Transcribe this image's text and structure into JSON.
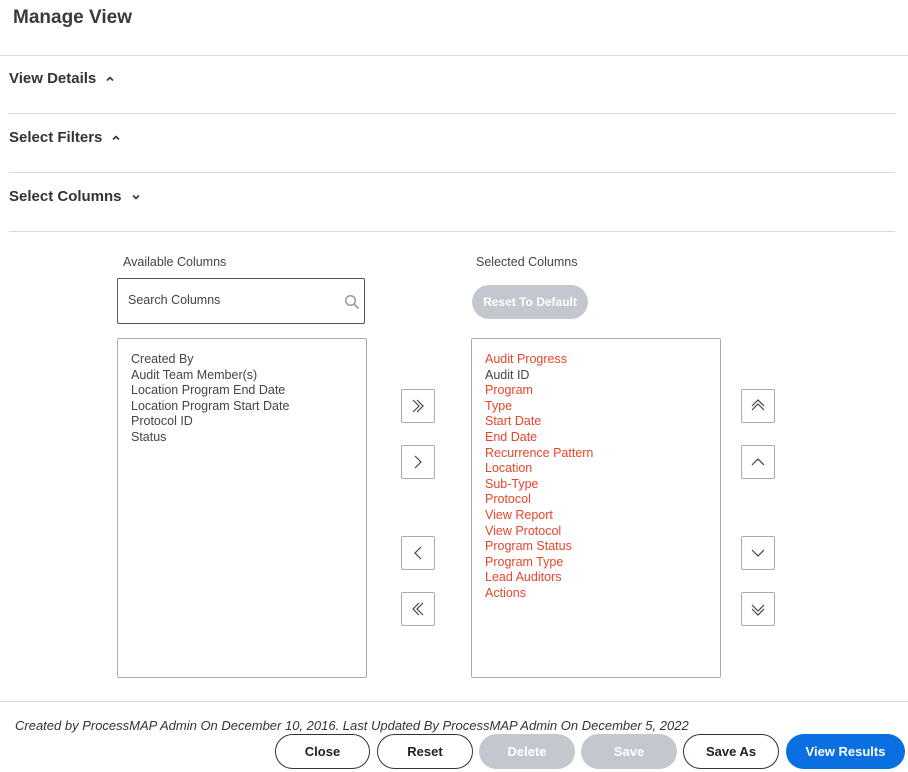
{
  "page": {
    "title": "Manage View"
  },
  "sections": {
    "view_details": "View Details",
    "select_filters": "Select Filters",
    "select_columns": "Select Columns"
  },
  "available": {
    "label": "Available Columns",
    "search_placeholder": "Search Columns",
    "items": [
      "Created By",
      "Audit Team Member(s)",
      "Location Program End Date",
      "Location Program Start Date",
      "Protocol ID",
      "Status"
    ]
  },
  "selected": {
    "label": "Selected Columns",
    "reset_label": "Reset To Default",
    "items": [
      "Audit Progress",
      "Audit ID",
      "Program",
      "Type",
      "Start Date",
      "End Date",
      "Recurrence Pattern",
      "Location",
      "Sub-Type",
      "Protocol",
      "View Report",
      "View Protocol",
      "Program Status",
      "Program Type",
      "Lead Auditors",
      "Actions"
    ]
  },
  "footer": {
    "meta": "Created by ProcessMAP Admin On December 10, 2016. Last Updated By ProcessMAP Admin On December 5, 2022",
    "close": "Close",
    "reset": "Reset",
    "delete": "Delete",
    "save": "Save",
    "save_as": "Save As",
    "view_results": "View Results"
  },
  "colors": {
    "highlight": "#e8452c",
    "primary": "#0a6fe0",
    "disabled": "#c4c8ce"
  },
  "icons": [
    "chevron-up-icon",
    "chevron-down-icon",
    "search-icon",
    "double-chevron-right-icon",
    "chevron-right-icon",
    "chevron-left-icon",
    "double-chevron-left-icon",
    "double-chevron-up-icon",
    "chevron-up-icon",
    "chevron-down-icon",
    "double-chevron-down-icon"
  ]
}
